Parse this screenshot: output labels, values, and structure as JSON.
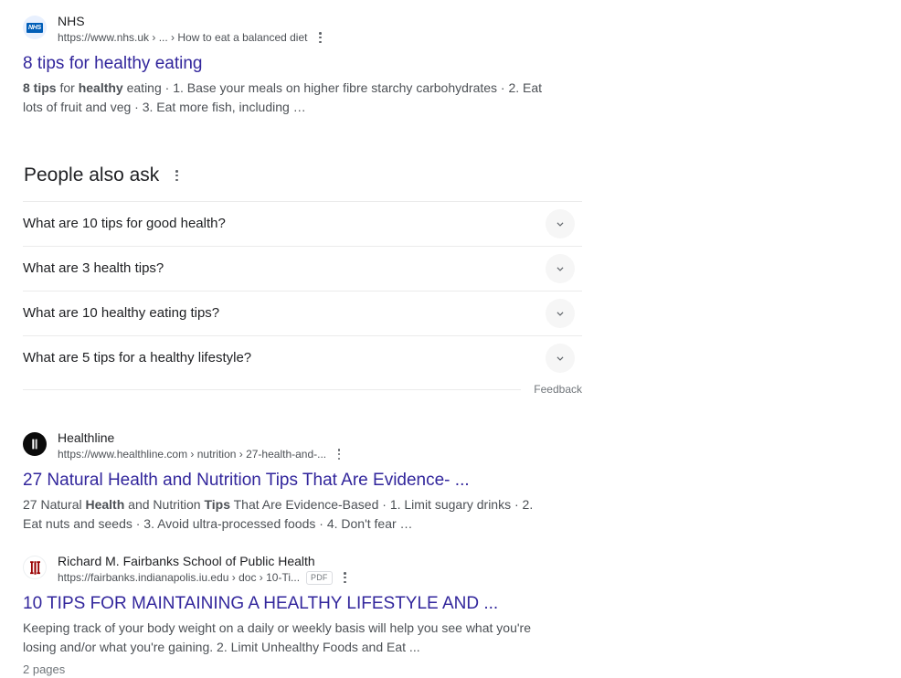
{
  "results": [
    {
      "id": "nhs",
      "site_name": "NHS",
      "favicon_label": "NHS",
      "url": "https://www.nhs.uk › ... › How to eat a balanced diet",
      "title": "8 tips for healthy eating",
      "snippet_lead": "8 tips",
      "snippet_mid": " for ",
      "snippet_bold2": "healthy",
      "snippet_rest": " eating · 1. Base your meals on higher fibre starchy carbohydrates · 2. Eat lots of fruit and veg · 3. Eat more fish, including ",
      "snippet_ellipsis": "…"
    },
    {
      "id": "healthline",
      "site_name": "Healthline",
      "url": "https://www.healthline.com › nutrition › 27-health-and-...",
      "title": "27 Natural Health and Nutrition Tips That Are Evidence- ...",
      "snippet_lead": "27 Natural ",
      "snippet_bold1": "Health",
      "snippet_mid": " and Nutrition ",
      "snippet_bold2": "Tips",
      "snippet_rest": " That Are Evidence-Based · 1. Limit sugary drinks · 2. Eat nuts and seeds · 3. Avoid ultra-processed foods · 4. Don't fear ",
      "snippet_ellipsis": "…"
    },
    {
      "id": "fairbanks",
      "site_name": "Richard M. Fairbanks School of Public Health",
      "url": "https://fairbanks.indianapolis.iu.edu › doc › 10-Ti...",
      "file_badge": "PDF",
      "title": "10 TIPS FOR MAINTAINING A HEALTHY LIFESTYLE AND ...",
      "snippet_text": "Keeping track of your body weight on a daily or weekly basis will help you see what you're losing and/or what you're gaining. 2. Limit Unhealthy Foods and Eat ...",
      "pages_label": "2 pages"
    }
  ],
  "people_also_ask": {
    "heading": "People also ask",
    "questions": [
      {
        "text": "What are 10 tips for good health?"
      },
      {
        "text": "What are 3 health tips?"
      },
      {
        "text": "What are 10 healthy eating tips?"
      },
      {
        "text": "What are 5 tips for a healthy lifestyle?"
      }
    ],
    "feedback_label": "Feedback"
  },
  "colors": {
    "link": "#32269c",
    "text": "#202124",
    "snippet": "#4d5156",
    "url": "#4d5156",
    "divider": "#ebebeb",
    "nhs_blue": "#005eb8",
    "iu_crimson": "#990000"
  }
}
